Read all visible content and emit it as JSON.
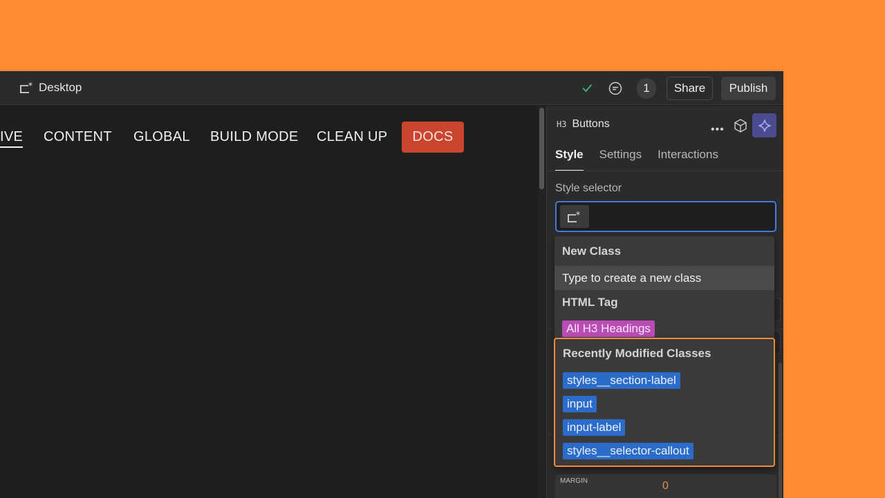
{
  "topbar": {
    "device_label": "Desktop",
    "collaborator_count": "1",
    "share_label": "Share",
    "publish_label": "Publish"
  },
  "canvas": {
    "nav_items": [
      "IVE",
      "CONTENT",
      "GLOBAL",
      "BUILD MODE",
      "CLEAN UP"
    ],
    "docs_label": "DOCS"
  },
  "panel": {
    "element_tag": "H3",
    "element_name": "Buttons",
    "tabs": [
      "Style",
      "Settings",
      "Interactions"
    ],
    "selector_label": "Style selector",
    "margin_label": "MARGIN",
    "margin_value": "0"
  },
  "dropdown": {
    "new_class_heading": "New Class",
    "new_class_option": "Type to create a new class",
    "html_tag_heading": "HTML Tag",
    "html_tag_pill": "All H3 Headings",
    "recent_heading": "Recently Modified Classes",
    "recent_classes": [
      "styles__section-label",
      "input",
      "input-label",
      "styles__selector-callout"
    ]
  },
  "colors": {
    "background": "#FF8A33",
    "docs_button": "#C9452F",
    "selector_focus": "#3F7BE0",
    "class_tag": "#2B6CCB",
    "html_tag": "#B94DB5",
    "highlight": "#FF8A33"
  }
}
